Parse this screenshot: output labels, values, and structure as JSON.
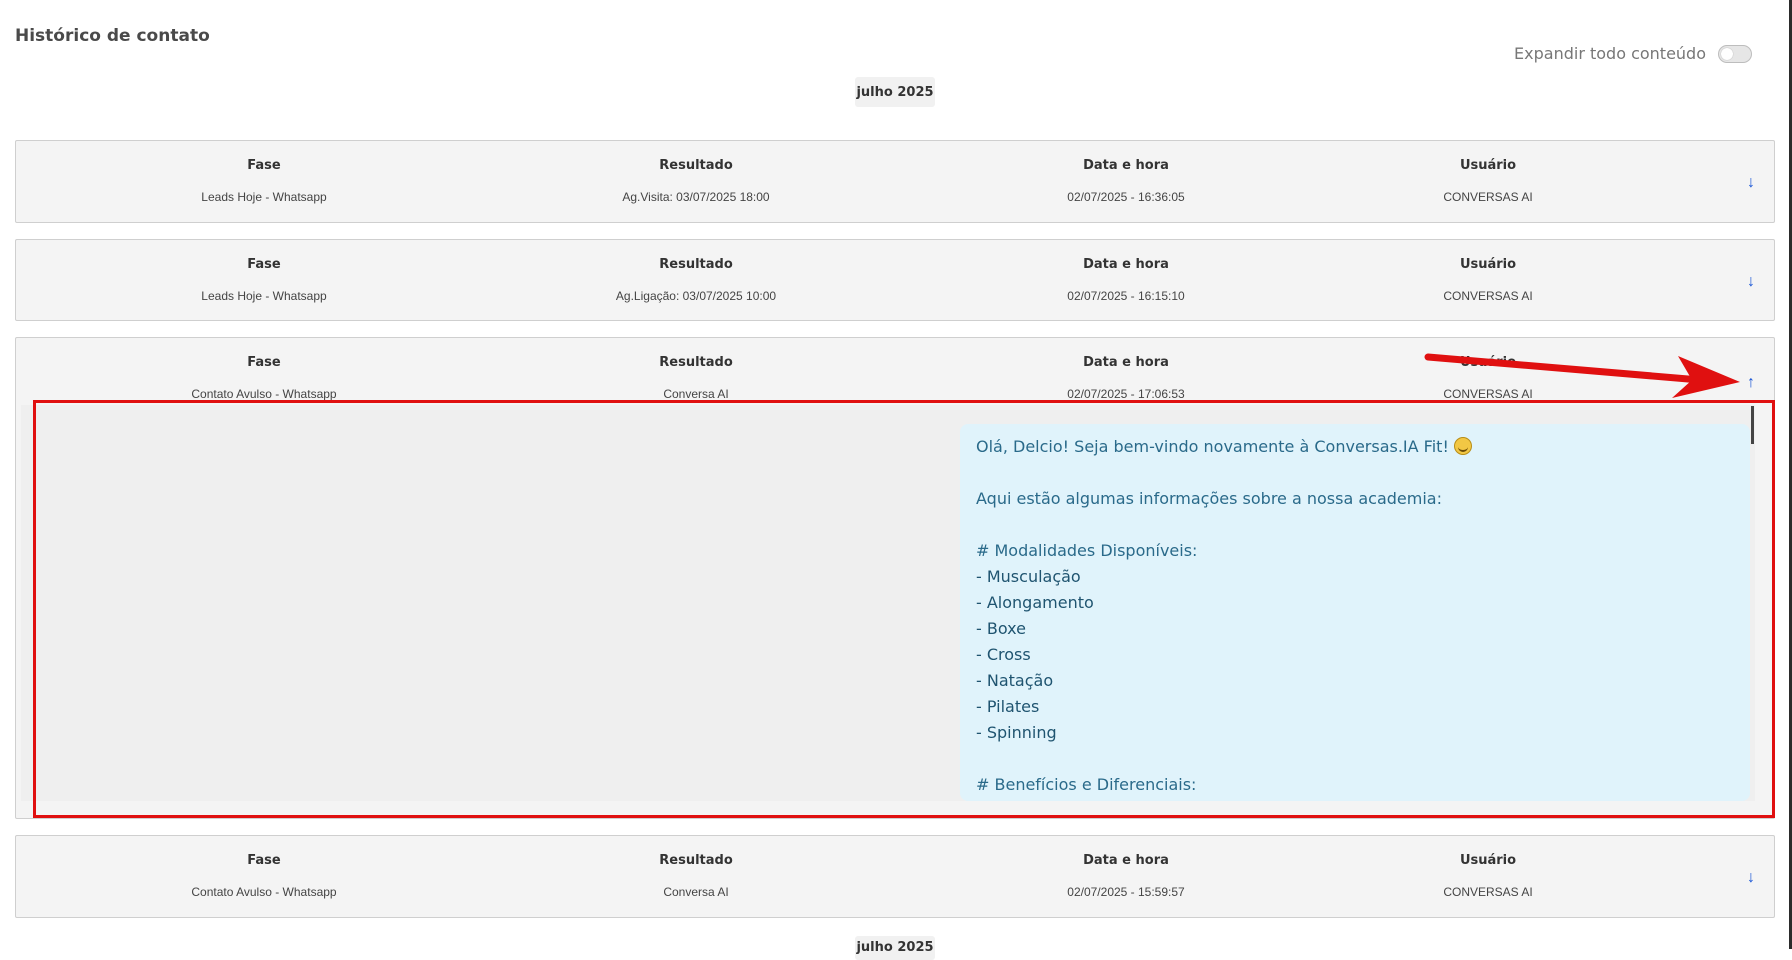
{
  "header": {
    "title": "Histórico de contato",
    "expand_label": "Expandir todo conteúdo"
  },
  "months": [
    "julho 2025",
    "julho 2025"
  ],
  "columns": {
    "fase": "Fase",
    "resultado": "Resultado",
    "data_hora": "Data e hora",
    "usuario": "Usuário"
  },
  "records": [
    {
      "fase": "Leads Hoje - Whatsapp",
      "resultado": "Ag.Visita: 03/07/2025 18:00",
      "data_hora": "02/07/2025 - 16:36:05",
      "usuario": "CONVERSAS AI",
      "toggle_icon": "arrow-down-icon"
    },
    {
      "fase": "Leads Hoje - Whatsapp",
      "resultado": "Ag.Ligação: 03/07/2025 10:00",
      "data_hora": "02/07/2025 - 16:15:10",
      "usuario": "CONVERSAS AI",
      "toggle_icon": "arrow-down-icon"
    },
    {
      "fase": "Contato Avulso - Whatsapp",
      "resultado": "Conversa AI",
      "data_hora": "02/07/2025 - 17:06:53",
      "usuario": "CONVERSAS AI",
      "toggle_icon": "arrow-up-icon"
    },
    {
      "fase": "Contato Avulso - Whatsapp",
      "resultado": "Conversa AI",
      "data_hora": "02/07/2025 - 15:59:57",
      "usuario": "CONVERSAS AI",
      "toggle_icon": "arrow-down-icon"
    }
  ],
  "message": {
    "greeting": "Olá, Delcio! Seja bem-vindo novamente à Conversas.IA Fit!",
    "greeting_icon": "smiling-face-emoji",
    "intro": "Aqui estão algumas informações sobre a nossa academia:",
    "modalities_heading": "# Modalidades Disponíveis:",
    "modalities": [
      "- Musculação",
      "- Alongamento",
      "- Boxe",
      "- Cross",
      "- Natação",
      "- Pilates",
      "- Spinning"
    ],
    "benefits_heading": "# Benefícios e Diferenciais:"
  },
  "colors": {
    "highlight": "#e01010",
    "accent": "#1a56d6",
    "bubble": "#e0f3fb"
  }
}
